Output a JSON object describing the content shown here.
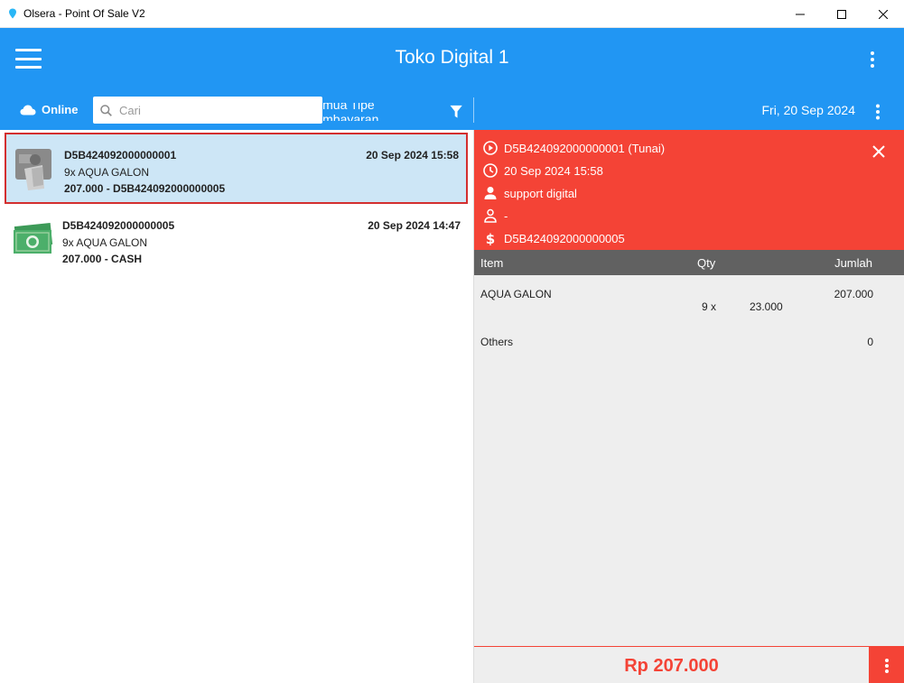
{
  "window": {
    "title": "Olsera - Point Of Sale V2"
  },
  "header": {
    "store_name": "Toko Digital 1",
    "status": "Online",
    "search_placeholder": "Cari",
    "payment_filter": "Semua Tipe Pembayaran",
    "date": "Fri, 20 Sep 2024"
  },
  "transactions": [
    {
      "id": "D5B424092000000001",
      "time": "20 Sep 2024 15:58",
      "items": "9x AQUA GALON",
      "total": "207.000 - D5B424092000000005",
      "selected": true
    },
    {
      "id": "D5B424092000000005",
      "time": "20 Sep 2024 14:47",
      "items": "9x AQUA GALON",
      "total": "207.000 - CASH",
      "selected": false
    }
  ],
  "detail": {
    "order": "D5B424092000000001 (Tunai)",
    "datetime": "20 Sep 2024 15:58",
    "staff": "support digital",
    "customer": "-",
    "payment_ref": "D5B424092000000005",
    "columns": {
      "item": "Item",
      "qty": "Qty",
      "amount": "Jumlah"
    },
    "rows": [
      {
        "name": "AQUA GALON",
        "qty": "9 x",
        "price": "23.000",
        "amount": "207.000"
      }
    ],
    "others_label": "Others",
    "others_amount": "0",
    "total": "Rp 207.000"
  },
  "colors": {
    "primary": "#2196F3",
    "accent": "#F44336",
    "selected_row": "#cde6f6",
    "table_header": "#616161"
  }
}
